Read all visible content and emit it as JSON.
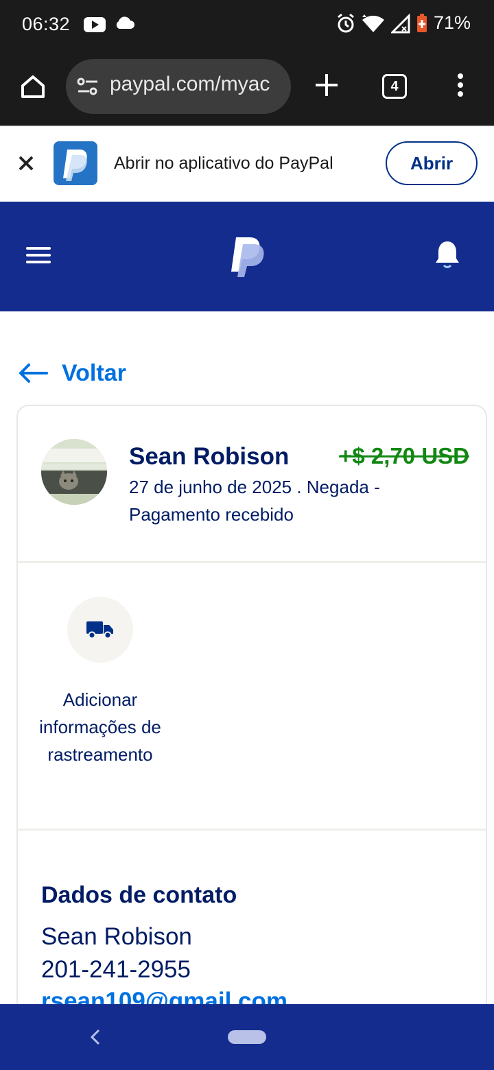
{
  "status_bar": {
    "time": "06:32",
    "battery": "71%",
    "icons": [
      "youtube-icon",
      "cloud-icon",
      "alarm-icon",
      "wifi-icon",
      "signal-icon",
      "battery-icon"
    ]
  },
  "browser": {
    "url": "paypal.com/myac",
    "tab_count": "4",
    "icons": [
      "home-icon",
      "site-settings-icon",
      "new-tab-icon",
      "tabs-icon",
      "more-menu-icon"
    ]
  },
  "app_banner": {
    "text": "Abrir no aplicativo do PayPal",
    "button_label": "Abrir",
    "close_symbol": "✕"
  },
  "colors": {
    "paypal_navy": "#142c8e",
    "link_blue": "#0070e0",
    "text_navy": "#001c64",
    "amount_green": "#118811"
  },
  "page": {
    "back_label": "Voltar"
  },
  "transaction": {
    "name": "Sean Robison",
    "amount": "+$ 2,70 USD",
    "description": "27 de junho de 2025 . Negada - Pagamento recebido",
    "tracking_label": "Adicionar informações de rastreamento"
  },
  "contact": {
    "title": "Dados de contato",
    "name": "Sean Robison",
    "phone": "201-241-2955",
    "email": "rsean109@gmail.com"
  }
}
